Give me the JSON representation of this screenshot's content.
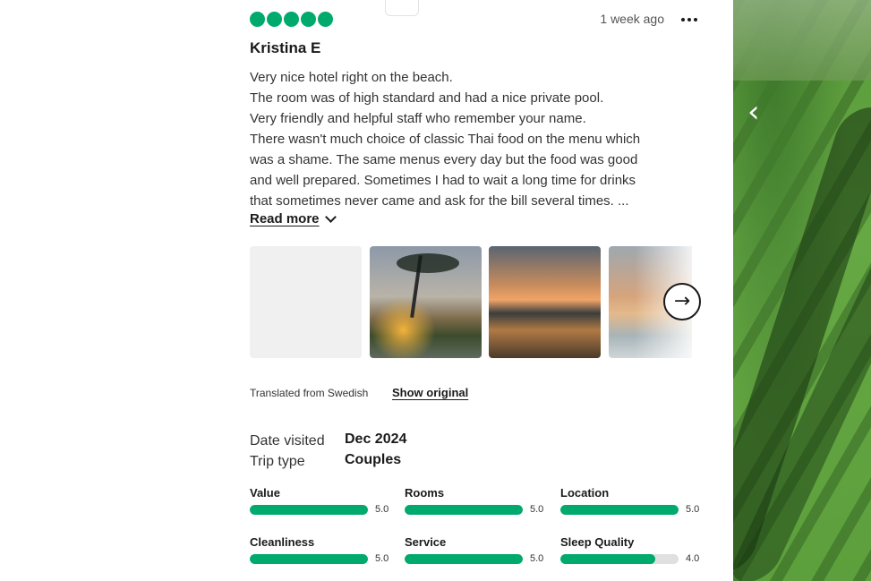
{
  "review": {
    "rating_bubbles": 5,
    "date": "1 week ago",
    "author": "Kristina E",
    "body_lines": [
      "Very nice hotel right on the beach.",
      "The room was of high standard and had a nice private pool.",
      "Very friendly and helpful staff who remember your name.",
      "There wasn't much choice of classic Thai food on the menu which",
      "was a shame. The same menus every day but the food was good",
      "and well prepared. Sometimes I had to wait a long time for drinks",
      "that sometimes never came and ask for the bill several times. ..."
    ],
    "read_more": "Read more",
    "translated_note": "Translated from Swedish",
    "show_original": "Show original",
    "date_visited_label": "Date visited",
    "date_visited_value": "Dec 2024",
    "trip_type_label": "Trip type",
    "trip_type_value": "Couples"
  },
  "ratings": [
    {
      "name": "Value",
      "score": "5.0",
      "fraction": 1.0
    },
    {
      "name": "Rooms",
      "score": "5.0",
      "fraction": 1.0
    },
    {
      "name": "Location",
      "score": "5.0",
      "fraction": 1.0
    },
    {
      "name": "Cleanliness",
      "score": "5.0",
      "fraction": 1.0
    },
    {
      "name": "Service",
      "score": "5.0",
      "fraction": 1.0
    },
    {
      "name": "Sleep Quality",
      "score": "4.0",
      "fraction": 0.8
    }
  ],
  "colors": {
    "accent": "#00aa6c",
    "track": "#e0e0e0",
    "text": "#1a1a1a"
  },
  "icons": {
    "more": "more-options-icon",
    "chevron": "chevron-down-icon",
    "next": "arrow-right-icon",
    "prev": "chevron-left-icon"
  }
}
